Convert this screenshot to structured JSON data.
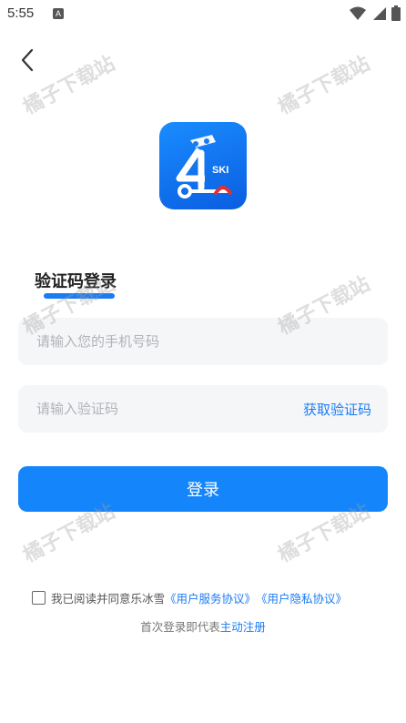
{
  "status_bar": {
    "time": "5:55",
    "notification_icon": "a-box-icon",
    "icons": [
      "wifi-icon",
      "signal-icon",
      "battery-icon"
    ]
  },
  "nav": {
    "back_icon": "chevron-left-icon"
  },
  "logo": {
    "icon": "app-logo-ski",
    "text": "SKI"
  },
  "login": {
    "title": "验证码登录",
    "phone_placeholder": "请输入您的手机号码",
    "phone_value": "",
    "code_placeholder": "请输入验证码",
    "code_value": "",
    "get_code_label": "获取验证码",
    "submit_label": "登录"
  },
  "agreement": {
    "checked": false,
    "prefix": "我已阅读并同意乐冰雪",
    "service_link": "《用户服务协议》",
    "privacy_link": "《用户隐私协议》"
  },
  "register": {
    "prefix": "首次登录即代表",
    "link": "主动注册"
  },
  "watermark": {
    "text": "橘子下载站"
  },
  "colors": {
    "accent": "#1a7cf5",
    "button": "#1485fb",
    "field_bg": "#f5f6f8",
    "logo_bg": "#0a5ee0"
  }
}
